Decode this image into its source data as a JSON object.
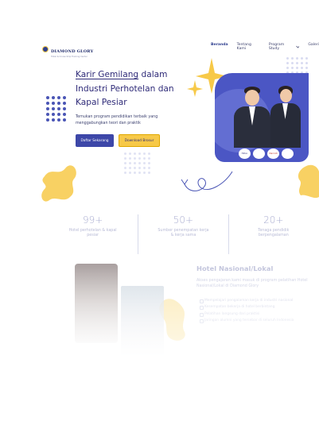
{
  "nav": {
    "logo_text": "DIAMOND GLORY",
    "logo_subtext": "Hotel & Cruise Ship Training Center",
    "links": [
      "Beranda",
      "Tentang Kami",
      "Program Study",
      "Galeri"
    ]
  },
  "hero": {
    "title_line1_underlined": "Karir Gemilang",
    "title_line1_rest": " dalam",
    "title_line2": "Industri Perhotelan dan",
    "title_line3": "Kapal Pesiar",
    "subtitle": "Temukan program pendidikan terbaik yang menggabungkan teori dan praktik",
    "primary_button": "Daftar Sekarang",
    "secondary_button": "Download Brosur",
    "partner_logos": [
      "Hilton",
      "",
      "Marriott",
      ""
    ]
  },
  "stats": [
    {
      "number": "99+",
      "label": "Hotel perhotelan & kapal pesiar"
    },
    {
      "number": "50+",
      "label": "Sumber penempatan kerja & kerja sama"
    },
    {
      "number": "20+",
      "label": "Tenaga pendidik berpengalaman"
    }
  ],
  "section": {
    "title": "Hotel Nasional/Lokal",
    "description": "Akses pengajaran kami masuk di program pelatihan Hotel Nasional/Lokal di Diamond Glory",
    "items": [
      "Mempelajari pengalaman kerja di industri nasional",
      "Kesempatan bekerja di hotel berbintang",
      "Pelatihan langsung dari praktisi",
      "Jaringan alumni yang tersebar di seluruh Indonesia"
    ]
  },
  "colors": {
    "primary": "#3d47a8",
    "accent": "#f7c948",
    "heading": "#2e2a78"
  }
}
